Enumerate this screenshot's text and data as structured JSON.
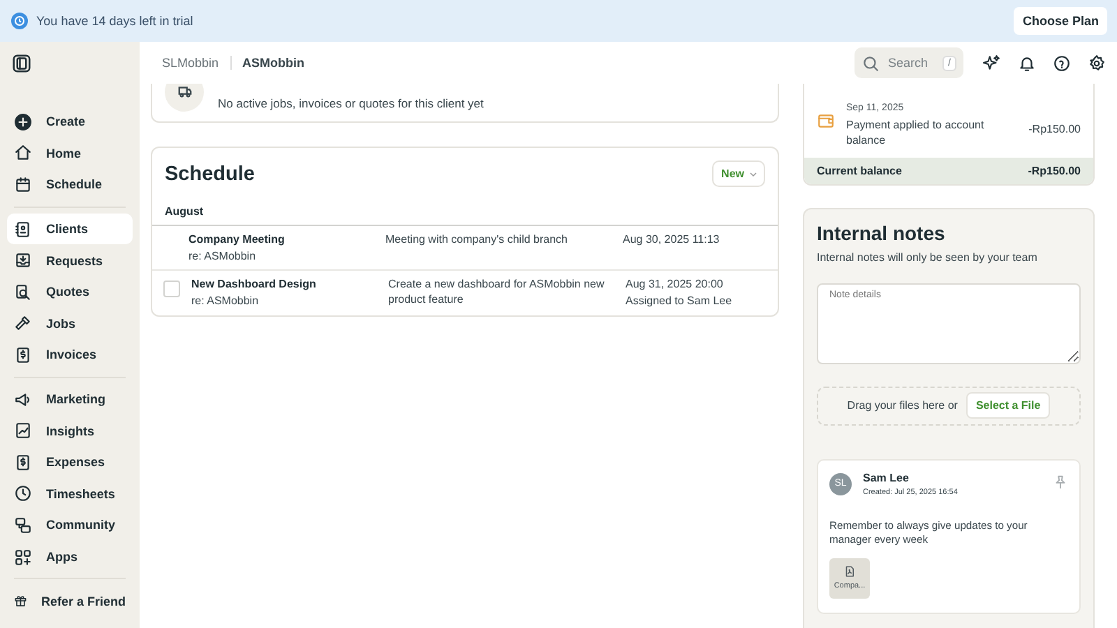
{
  "banner": {
    "message": "You have 14 days left in trial",
    "button": "Choose Plan"
  },
  "sidebar": {
    "groups": [
      [
        {
          "label": "Create",
          "selected": false
        },
        {
          "label": "Home",
          "selected": false
        },
        {
          "label": "Schedule",
          "selected": false
        }
      ],
      [
        {
          "label": "Clients",
          "selected": true
        },
        {
          "label": "Requests",
          "selected": false
        },
        {
          "label": "Quotes",
          "selected": false
        },
        {
          "label": "Jobs",
          "selected": false
        },
        {
          "label": "Invoices",
          "selected": false
        }
      ],
      [
        {
          "label": "Marketing",
          "selected": false
        },
        {
          "label": "Insights",
          "selected": false
        },
        {
          "label": "Expenses",
          "selected": false
        },
        {
          "label": "Timesheets",
          "selected": false
        },
        {
          "label": "Community",
          "selected": false
        },
        {
          "label": "Apps",
          "selected": false
        }
      ],
      [
        {
          "label": "Refer a Friend",
          "selected": false
        }
      ]
    ]
  },
  "topbar": {
    "breadcrumbs": [
      "SLMobbin",
      "ASMobbin"
    ],
    "search": {
      "placeholder": "Search",
      "shortcut": "/"
    }
  },
  "client_card": {
    "message": "No active jobs, invoices or quotes for this client yet"
  },
  "schedule": {
    "title": "Schedule",
    "new_button": "New",
    "groups": [
      {
        "heading": "August",
        "items": [
          {
            "kind": "event",
            "title": "Company Meeting",
            "client": "re: ASMobbin",
            "description": "Meeting with company's child branch",
            "date": "Aug 30, 2025 11:13"
          },
          {
            "kind": "task",
            "checked": false,
            "title": "New Dashboard Design",
            "client": "re: ASMobbin",
            "description": "Create a new dashboard for ASMobbin new product feature",
            "date": "Aug 31, 2025 20:00",
            "assignee": "Assigned to Sam Lee"
          }
        ]
      }
    ]
  },
  "billing": {
    "entries": [
      {
        "date": "Sep 11, 2025",
        "description": "Payment applied to account balance",
        "amount": "-Rp150.00"
      }
    ],
    "balance_label": "Current balance",
    "balance": "-Rp150.00"
  },
  "notes": {
    "title": "Internal notes",
    "subtitle": "Internal notes will only be seen by your team",
    "placeholder": "Note details",
    "drop_text": "Drag your files here or",
    "select_button": "Select a File",
    "items": [
      {
        "author": "Sam Lee",
        "initials": "SL",
        "created": "Created: Jul 25, 2025 16:54",
        "body": "Remember to always give updates to your manager every week",
        "pinned": false,
        "attachments": [
          {
            "name": "Compa..."
          }
        ]
      }
    ]
  }
}
